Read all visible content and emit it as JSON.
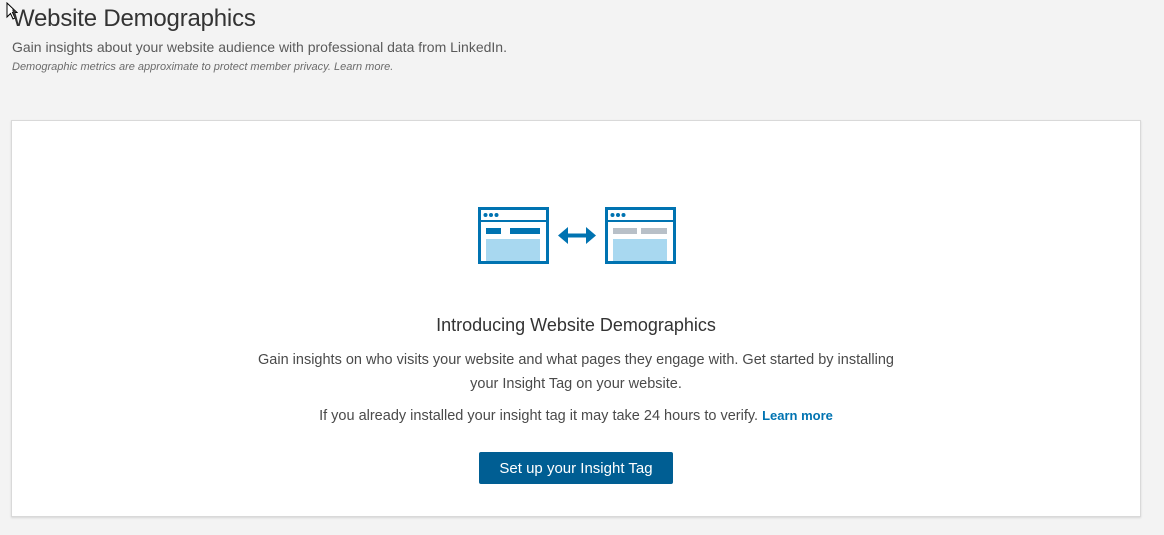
{
  "header": {
    "title": "Website Demographics",
    "subtitle": "Gain insights about your website audience with professional data from LinkedIn.",
    "note": "Demographic metrics are approximate to protect member privacy.",
    "note_link": "Learn more."
  },
  "intro": {
    "title": "Introducing Website Demographics",
    "body": "Gain insights on who visits your website and what pages they engage with. Get started by installing your Insight Tag on your website.",
    "verify_text": "If you already installed your insight tag it may take 24 hours to verify.",
    "learn_more_label": "Learn more",
    "setup_button_label": "Set up your Insight Tag"
  },
  "icons": {
    "cursor": "mouse-pointer-icon",
    "illustration": "website-sync-icon"
  },
  "colors": {
    "page_background": "#f3f3f3",
    "card_background": "#ffffff",
    "primary_button": "#005e93",
    "link": "#0073b1",
    "illustration_blue": "#0073b1",
    "illustration_light": "#a8d8f0",
    "illustration_gray": "#b8c0c8"
  }
}
